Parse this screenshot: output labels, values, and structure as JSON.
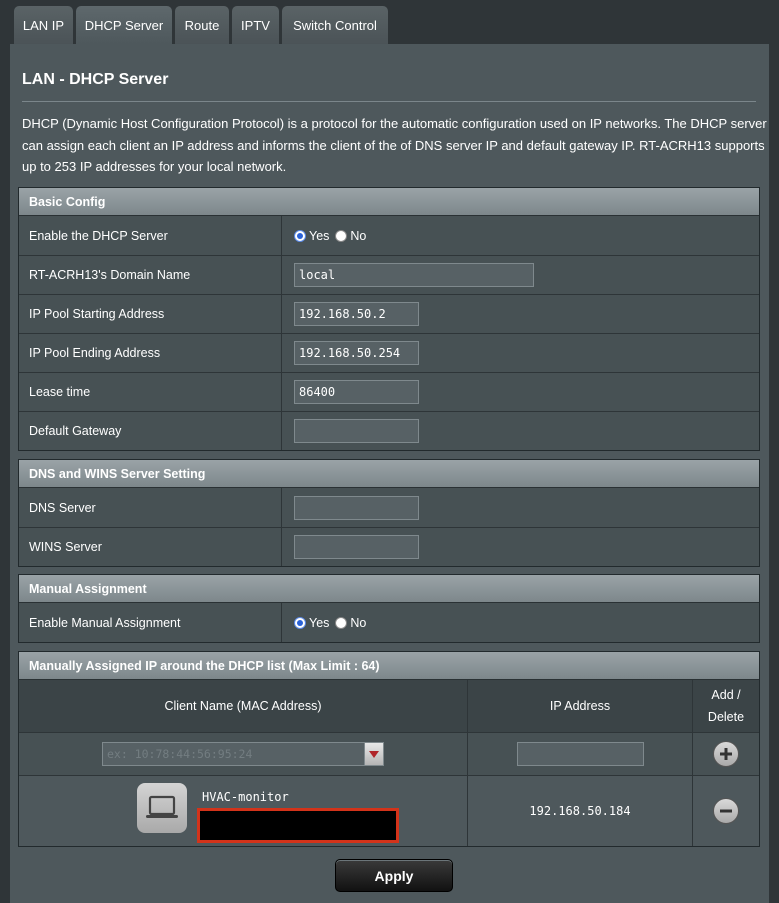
{
  "tabs": [
    {
      "label": "LAN IP"
    },
    {
      "label": "DHCP Server"
    },
    {
      "label": "Route"
    },
    {
      "label": "IPTV"
    },
    {
      "label": "Switch Control"
    }
  ],
  "page": {
    "title": "LAN - DHCP Server",
    "description": "DHCP (Dynamic Host Configuration Protocol) is a protocol for the automatic configuration used on IP networks. The DHCP server can assign each client an IP address and informs the client of the of DNS server IP and default gateway IP. RT-ACRH13 supports up to 253 IP addresses for your local network."
  },
  "basic_config": {
    "header": "Basic Config",
    "enable_dhcp": {
      "label": "Enable the DHCP Server",
      "yes": "Yes",
      "no": "No",
      "selected": "Yes"
    },
    "domain_name": {
      "label": "RT-ACRH13's Domain Name",
      "value": "local"
    },
    "pool_start": {
      "label": "IP Pool Starting Address",
      "value": "192.168.50.2"
    },
    "pool_end": {
      "label": "IP Pool Ending Address",
      "value": "192.168.50.254"
    },
    "lease_time": {
      "label": "Lease time",
      "value": "86400"
    },
    "default_gateway": {
      "label": "Default Gateway",
      "value": ""
    }
  },
  "dns_wins": {
    "header": "DNS and WINS Server Setting",
    "dns": {
      "label": "DNS Server",
      "value": ""
    },
    "wins": {
      "label": "WINS Server",
      "value": ""
    }
  },
  "manual_assignment": {
    "header": "Manual Assignment",
    "enable": {
      "label": "Enable Manual Assignment",
      "yes": "Yes",
      "no": "No",
      "selected": "Yes"
    }
  },
  "manual_list": {
    "header": "Manually Assigned IP around the DHCP list (Max Limit : 64)",
    "columns": {
      "client": "Client Name (MAC Address)",
      "ip": "IP Address",
      "add_delete_1": "Add /",
      "add_delete_2": "Delete"
    },
    "new_entry": {
      "mac_placeholder": "ex: 10:78:44:56:95:24",
      "ip_value": ""
    },
    "entries": [
      {
        "client_name": "HVAC-monitor",
        "ip": "192.168.50.184"
      }
    ]
  },
  "apply_label": "Apply",
  "colors": {
    "background": "#2f3538",
    "panel": "#4e585c",
    "section_header": "#8a9398",
    "redaction_border": "#d3331a"
  }
}
